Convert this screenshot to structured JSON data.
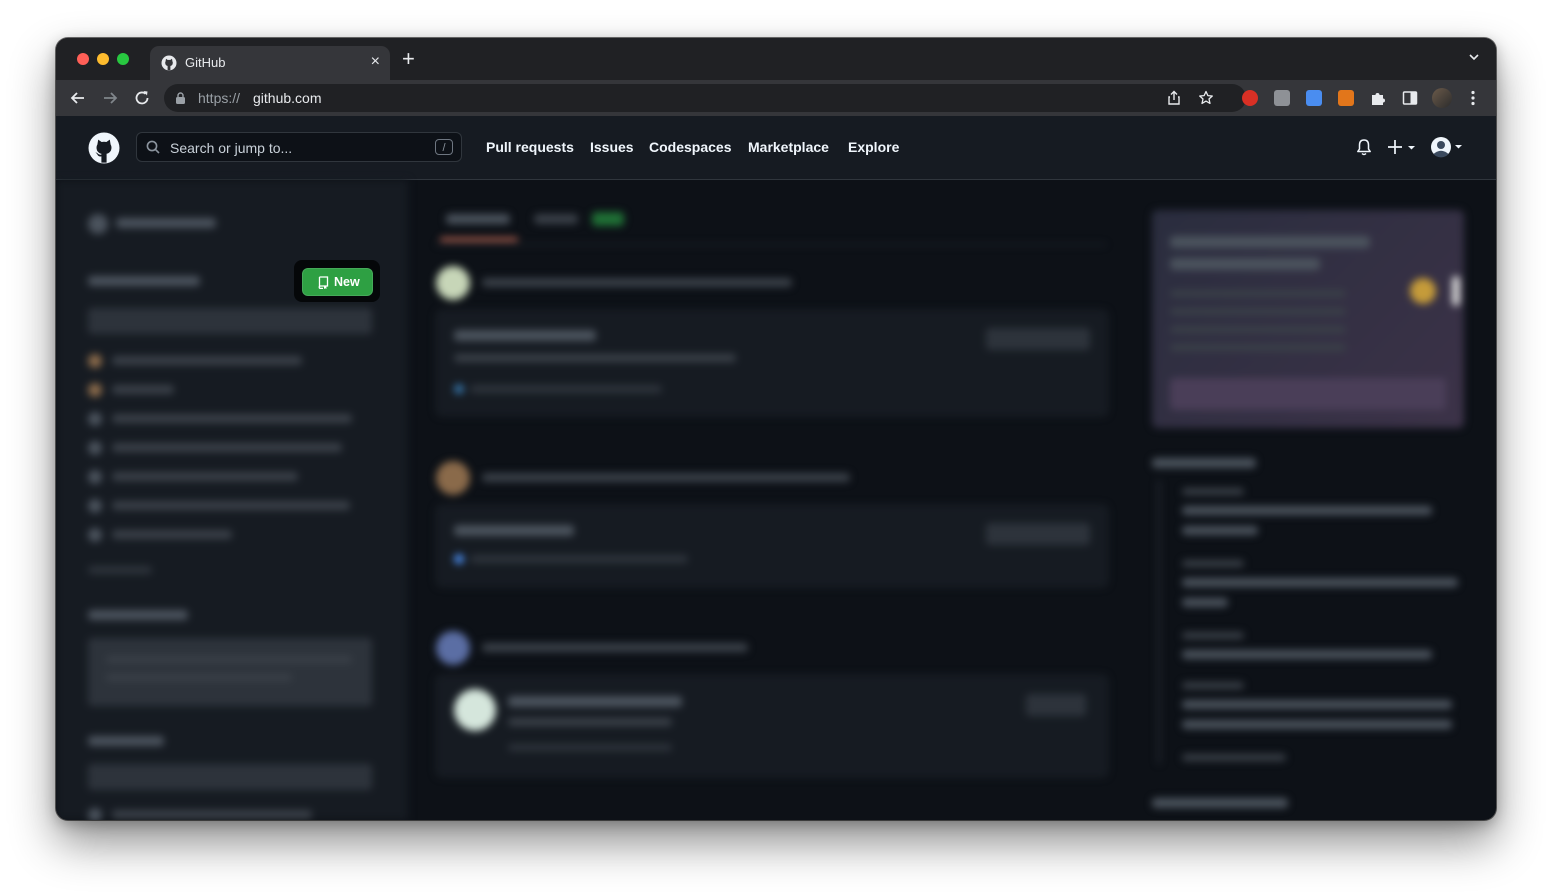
{
  "browser": {
    "tab_title": "GitHub",
    "tab_close": "×",
    "new_tab": "+",
    "url_prefix": "https://",
    "url_host": "github.com"
  },
  "header": {
    "search_placeholder": "Search or jump to...",
    "search_shortcut": "/",
    "nav": [
      "Pull requests",
      "Issues",
      "Codespaces",
      "Marketplace",
      "Explore"
    ]
  },
  "dashboard": {
    "new_repo_button": "New"
  },
  "colors": {
    "browser_tabbar": "#202124",
    "browser_toolbar": "#35363a",
    "gh_header": "#161b22",
    "page_bg": "#0d1117",
    "accent_green": "#2ea043"
  }
}
